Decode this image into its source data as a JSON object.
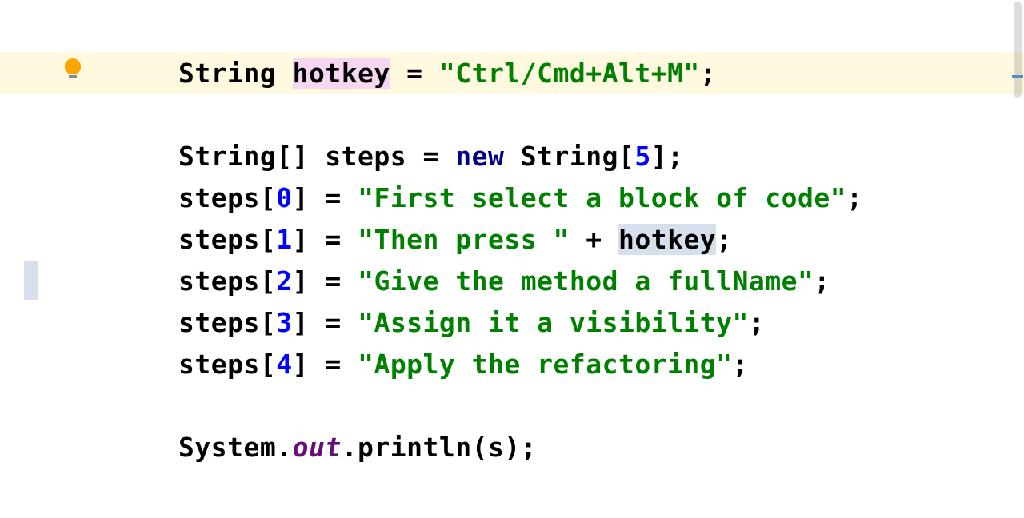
{
  "code": {
    "line1": {
      "type": "String",
      "var": "hotkey",
      "eq": " = ",
      "str": "\"Ctrl/Cmd+Alt+M\"",
      "semi": ";"
    },
    "line2_blank": "",
    "line3": {
      "pre": "String[] steps = ",
      "kw": "new",
      "post1": " String[",
      "num": "5",
      "post2": "];"
    },
    "line4": {
      "pre": "steps[",
      "idx": "0",
      "mid": "] = ",
      "str": "\"First select a block of code\"",
      "semi": ";"
    },
    "line5": {
      "pre": "steps[",
      "idx": "1",
      "mid": "] = ",
      "str": "\"Then press \"",
      "plus": " + ",
      "ref": "hotkey",
      "semi": ";"
    },
    "line6": {
      "pre": "steps[",
      "idx": "2",
      "mid": "] = ",
      "str": "\"Give the method a fullName\"",
      "semi": ";"
    },
    "line7": {
      "pre": "steps[",
      "idx": "3",
      "mid": "] = ",
      "str": "\"Assign it a visibility\"",
      "semi": ";"
    },
    "line8": {
      "pre": "steps[",
      "idx": "4",
      "mid": "] = ",
      "str": "\"Apply the refactoring\"",
      "semi": ";"
    },
    "line9_blank": "",
    "line10": {
      "sys": "System.",
      "out": "out",
      "rest": ".println(s);"
    }
  },
  "icons": {
    "bulb": "intention-bulb-icon"
  }
}
